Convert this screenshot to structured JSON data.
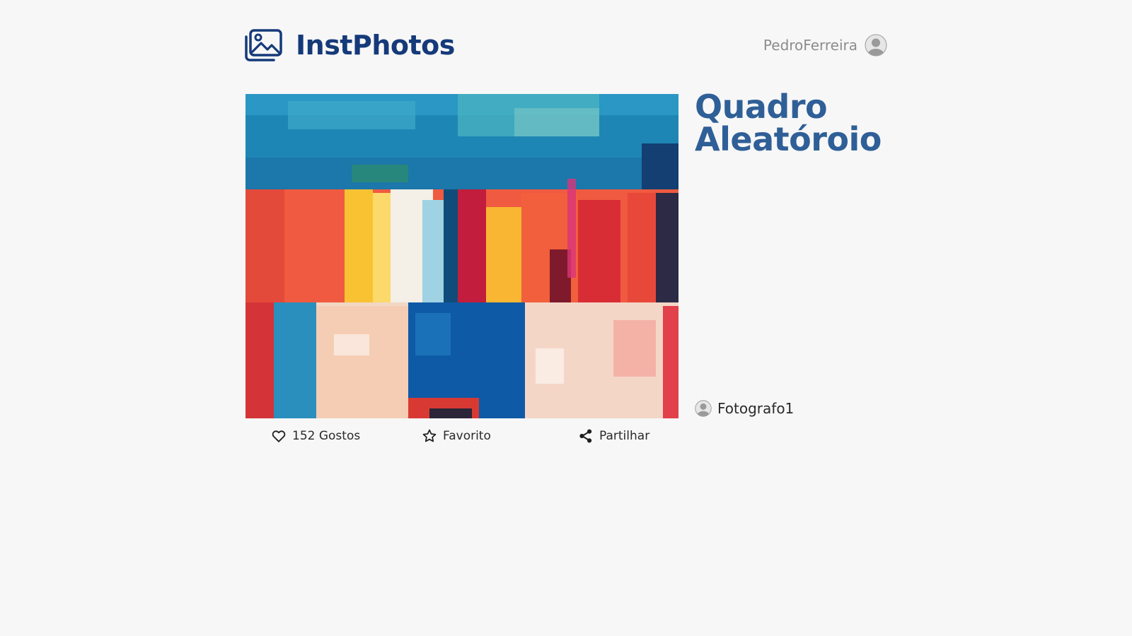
{
  "header": {
    "logo_text": "InstPhotos",
    "logo_icon": "photo-gallery-icon",
    "user_name": "PedroFerreira",
    "user_avatar_icon": "user-avatar-icon"
  },
  "post": {
    "title": "Quadro Aleatóroio",
    "image_description_icon": "abstract-painting",
    "author": "Fotografo1",
    "actions": {
      "likes_label": "152 Gostos",
      "favorite_label": "Favorito",
      "share_label": "Partilhar"
    }
  },
  "colors": {
    "brand": "#153a7a",
    "title": "#2f5f97",
    "muted": "#8c8c8c",
    "background": "#f7f7f7"
  }
}
